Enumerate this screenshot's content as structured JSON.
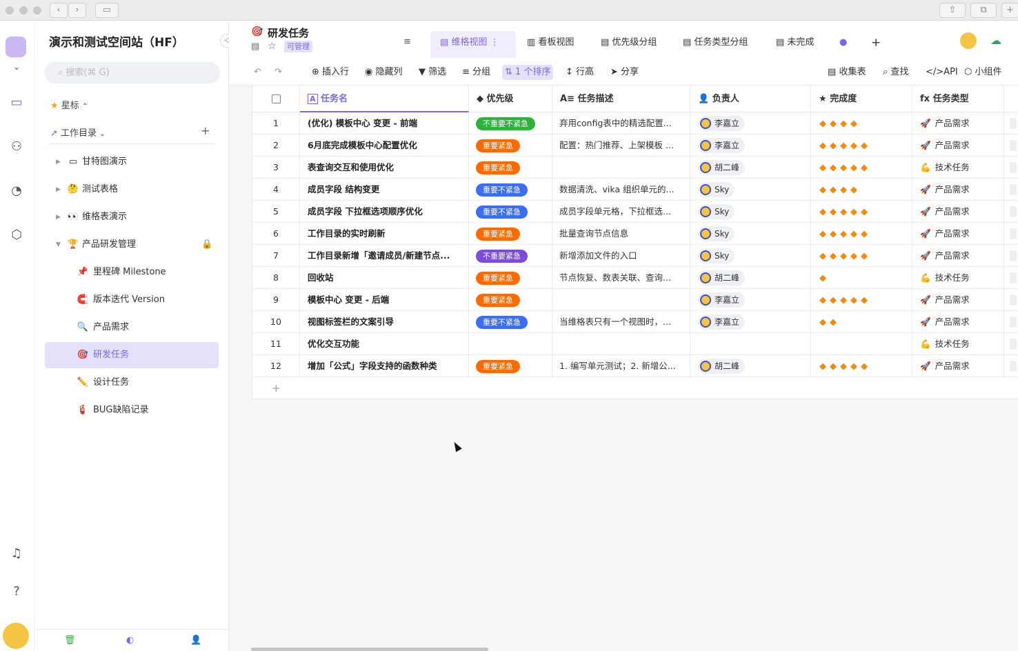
{
  "window": {
    "back": "‹",
    "forward": "›"
  },
  "space": {
    "title": "演示和测试空间站（HF）",
    "search_placeholder": "搜索(⌘ G)"
  },
  "sidebar": {
    "starred": "星标",
    "catalog": "工作目录",
    "add": "+",
    "items": [
      {
        "label": "甘特图演示",
        "icon": "folder-icon",
        "glyph": "▭"
      },
      {
        "label": "测试表格",
        "icon": "thinking-face-icon",
        "glyph": "🤔"
      },
      {
        "label": "维格表演示",
        "icon": "eyes-icon",
        "glyph": "👀"
      },
      {
        "label": "产品研发管理",
        "icon": "trophy-icon",
        "glyph": "🏆"
      },
      {
        "label": "里程碑 Milestone",
        "icon": "pushpin-icon",
        "glyph": "📌"
      },
      {
        "label": "版本迭代 Version",
        "icon": "magnet-icon",
        "glyph": "🧲"
      },
      {
        "label": "产品需求",
        "icon": "magnifier-icon",
        "glyph": "🔍"
      },
      {
        "label": "研发任务",
        "icon": "target-icon",
        "glyph": "🎯"
      },
      {
        "label": "设计任务",
        "icon": "pencil-icon",
        "glyph": "✏️"
      },
      {
        "label": "BUG缺陷记录",
        "icon": "extinguisher-icon",
        "glyph": "🧯"
      }
    ]
  },
  "datasheet": {
    "icon": "🎯",
    "title": "研发任务",
    "badge": "可管理",
    "tabs": [
      "维格视图",
      "看板视图",
      "优先级分组",
      "任务类型分组",
      "未完成"
    ],
    "add_tab": "+"
  },
  "toolbar": {
    "insert": "插入行",
    "hide": "隐藏列",
    "filter": "筛选",
    "group": "分组",
    "sort": "1 个排序",
    "height": "行高",
    "share": "分享",
    "form": "收集表",
    "find": "查找",
    "api": "API",
    "widget": "小组件"
  },
  "table": {
    "columns": [
      "任务名",
      "优先级",
      "任务描述",
      "负责人",
      "完成度",
      "任务类型"
    ],
    "column_icons": [
      "A",
      "◆",
      "A≡",
      "👤",
      "★",
      "fx"
    ],
    "add_row": "+",
    "rows": [
      {
        "no": "1",
        "name": "(优化) 模板中心 变更 - 前端",
        "priority": "不重要不紧急",
        "pcolor": "#2fb23c",
        "desc": "弃用config表中的精选配置...",
        "owner": "李嘉立",
        "rating": 4,
        "type": "产品需求",
        "ticon": "🚀"
      },
      {
        "no": "2",
        "name": "6月底完成模板中心配置优化",
        "priority": "重要紧急",
        "pcolor": "#ff6b00",
        "desc": "配置：热门推荐、上架模板 ...",
        "owner": "李嘉立",
        "rating": 5,
        "type": "产品需求",
        "ticon": "🚀"
      },
      {
        "no": "3",
        "name": "表查询交互和使用优化",
        "priority": "重要紧急",
        "pcolor": "#ff6b00",
        "desc": "",
        "owner": "胡二峰",
        "rating": 5,
        "type": "技术任务",
        "ticon": "💪"
      },
      {
        "no": "4",
        "name": "成员字段 结构变更",
        "priority": "重要不紧急",
        "pcolor": "#3b6ef5",
        "desc": "数据清洗、vika 组织单元的...",
        "owner": "Sky",
        "rating": 4,
        "type": "产品需求",
        "ticon": "🚀"
      },
      {
        "no": "5",
        "name": "成员字段 下拉框选项顺序优化",
        "priority": "重要不紧急",
        "pcolor": "#3b6ef5",
        "desc": "成员字段单元格，下拉框选...",
        "owner": "Sky",
        "rating": 5,
        "type": "产品需求",
        "ticon": "🚀"
      },
      {
        "no": "6",
        "name": "工作目录的实时刷新",
        "priority": "重要紧急",
        "pcolor": "#ff6b00",
        "desc": "批量查询节点信息",
        "owner": "Sky",
        "rating": 5,
        "type": "产品需求",
        "ticon": "🚀"
      },
      {
        "no": "7",
        "name": "工作目录新增「邀请成员/新建节点...",
        "priority": "不重要紧急",
        "pcolor": "#7b4cd9",
        "desc": "新增添加文件的入口",
        "owner": "Sky",
        "rating": 5,
        "type": "产品需求",
        "ticon": "🚀"
      },
      {
        "no": "8",
        "name": "回收站",
        "priority": "重要紧急",
        "pcolor": "#ff6b00",
        "desc": "节点恢复、数表关联、查询...",
        "owner": "胡二峰",
        "rating": 1,
        "type": "技术任务",
        "ticon": "💪"
      },
      {
        "no": "9",
        "name": "模板中心 变更 - 后端",
        "priority": "重要紧急",
        "pcolor": "#ff6b00",
        "desc": "",
        "owner": "李嘉立",
        "rating": 5,
        "type": "产品需求",
        "ticon": "🚀"
      },
      {
        "no": "10",
        "name": "视图标签栏的文案引导",
        "priority": "重要不紧急",
        "pcolor": "#3b6ef5",
        "desc": "当维格表只有一个视图时，...",
        "owner": "李嘉立",
        "rating": 2,
        "type": "产品需求",
        "ticon": "🚀"
      },
      {
        "no": "11",
        "name": "优化交互功能",
        "priority": "",
        "pcolor": "",
        "desc": "",
        "owner": "",
        "rating": 0,
        "type": "技术任务",
        "ticon": "💪"
      },
      {
        "no": "12",
        "name": "增加「公式」字段支持的函数种类",
        "priority": "重要紧急",
        "pcolor": "#ff6b00",
        "desc": "1. 编写单元测试；2. 新增公...",
        "owner": "胡二峰",
        "rating": 5,
        "type": "产品需求",
        "ticon": "🚀"
      }
    ]
  }
}
